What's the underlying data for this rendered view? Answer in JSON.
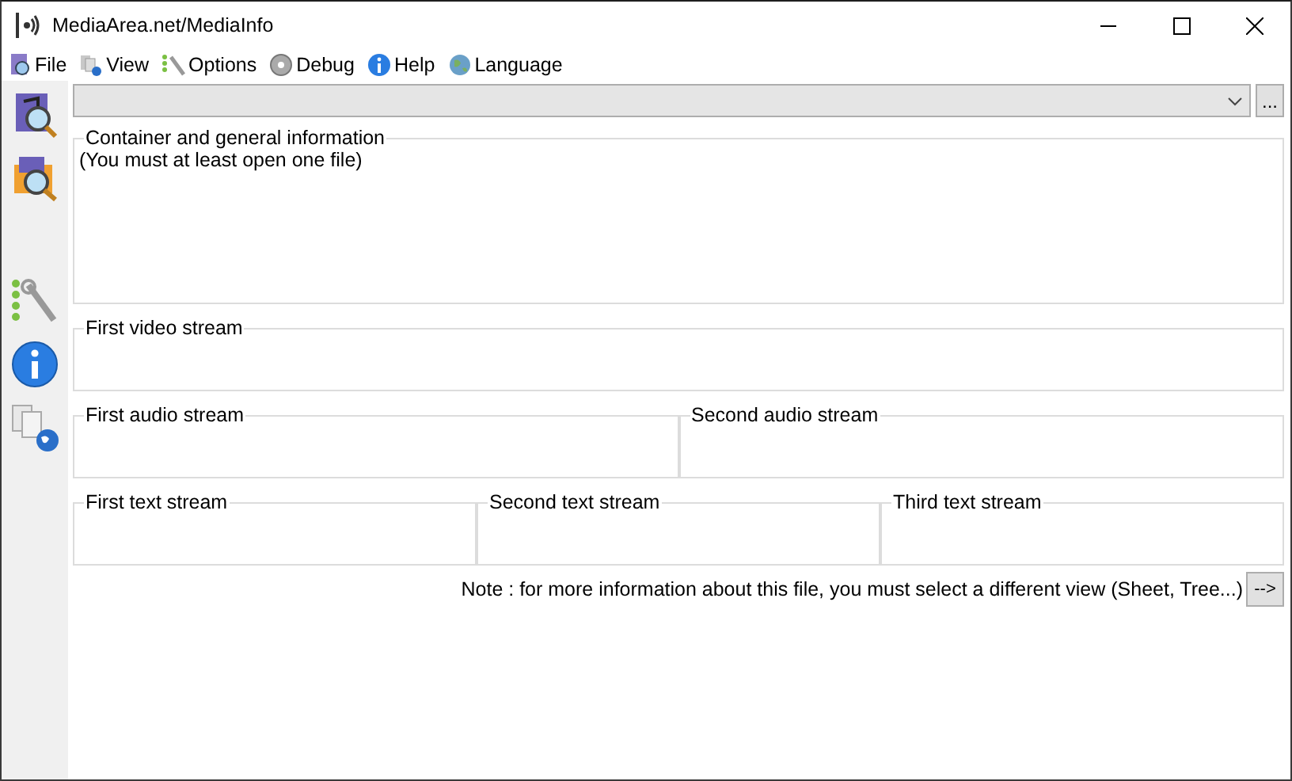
{
  "window": {
    "title": "MediaArea.net/MediaInfo"
  },
  "menu": [
    {
      "label": "File"
    },
    {
      "label": "View"
    },
    {
      "label": "Options"
    },
    {
      "label": "Debug"
    },
    {
      "label": "Help"
    },
    {
      "label": "Language"
    }
  ],
  "file_combo": {
    "browse_label": "..."
  },
  "groups": [
    [
      {
        "title": "Container and general information",
        "body": "(You must at least open one file)"
      }
    ],
    [
      {
        "title": "First video stream"
      }
    ],
    [
      {
        "title": "First audio stream"
      },
      {
        "title": "Second audio stream"
      }
    ],
    [
      {
        "title": "First text stream"
      },
      {
        "title": "Second text stream"
      },
      {
        "title": "Third text stream"
      }
    ]
  ],
  "note": {
    "text": "Note : for more information about this file, you must select a different view (Sheet, Tree...)",
    "button": "-->"
  }
}
